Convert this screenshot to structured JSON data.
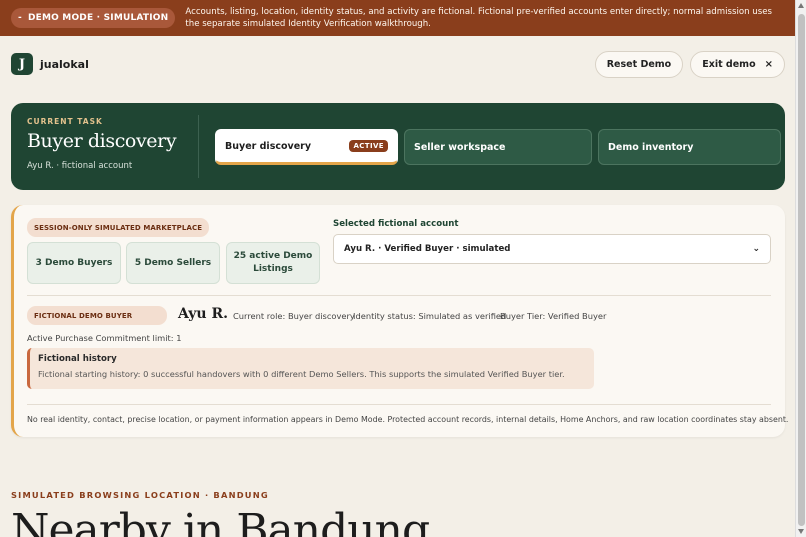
{
  "banner": {
    "pill_dash": "-",
    "pill_label": "DEMO MODE · SIMULATION",
    "text": "Accounts, listing, location, identity status, and activity are fictional. Fictional pre-verified accounts enter directly; normal admission uses the separate simulated Identity Verification walkthrough."
  },
  "header": {
    "logo_letter": "J",
    "brand": "jualokal",
    "reset_label": "Reset Demo",
    "exit_label": "Exit demo",
    "exit_icon": "×"
  },
  "task": {
    "eyebrow": "CURRENT TASK",
    "title": "Buyer discovery",
    "subtitle": "Ayu R. · fictional account",
    "tabs": [
      {
        "label": "Buyer discovery",
        "badge": "ACTIVE"
      },
      {
        "label": "Seller workspace"
      },
      {
        "label": "Demo inventory"
      }
    ]
  },
  "panel": {
    "marketplace_chip": "SESSION-ONLY SIMULATED MARKETPLACE",
    "stats": [
      {
        "label": "3 Demo Buyers"
      },
      {
        "label": "5 Demo Sellers"
      },
      {
        "label": "25 active Demo Listings"
      }
    ],
    "account_label": "Selected fictional account",
    "account_value": "Ayu R. · Verified Buyer · simulated",
    "buyer_chip": "FICTIONAL DEMO BUYER",
    "buyer_name": "Ayu R.",
    "role": "Current role: Buyer discovery",
    "identity": "Identity status: Simulated as verified",
    "tier": "Buyer Tier: Verified Buyer",
    "limit": "Active Purchase Commitment limit: 1",
    "history_title": "Fictional history",
    "history_text": "Fictional starting history: 0 successful handovers with 0 different Demo Sellers. This supports the simulated Verified Buyer tier.",
    "privacy": "No real identity, contact, precise location, or payment information appears in Demo Mode. Protected account records, internal details, Home Anchors, and raw location coordinates stay absent."
  },
  "location": {
    "eyebrow": "SIMULATED BROWSING LOCATION · BANDUNG",
    "title": "Nearby in Bandung"
  },
  "colors": {
    "brand_green": "#1f4533",
    "accent_rust": "#8a3e1c",
    "accent_amber": "#e3a54a",
    "page_bg": "#f3efe7"
  }
}
